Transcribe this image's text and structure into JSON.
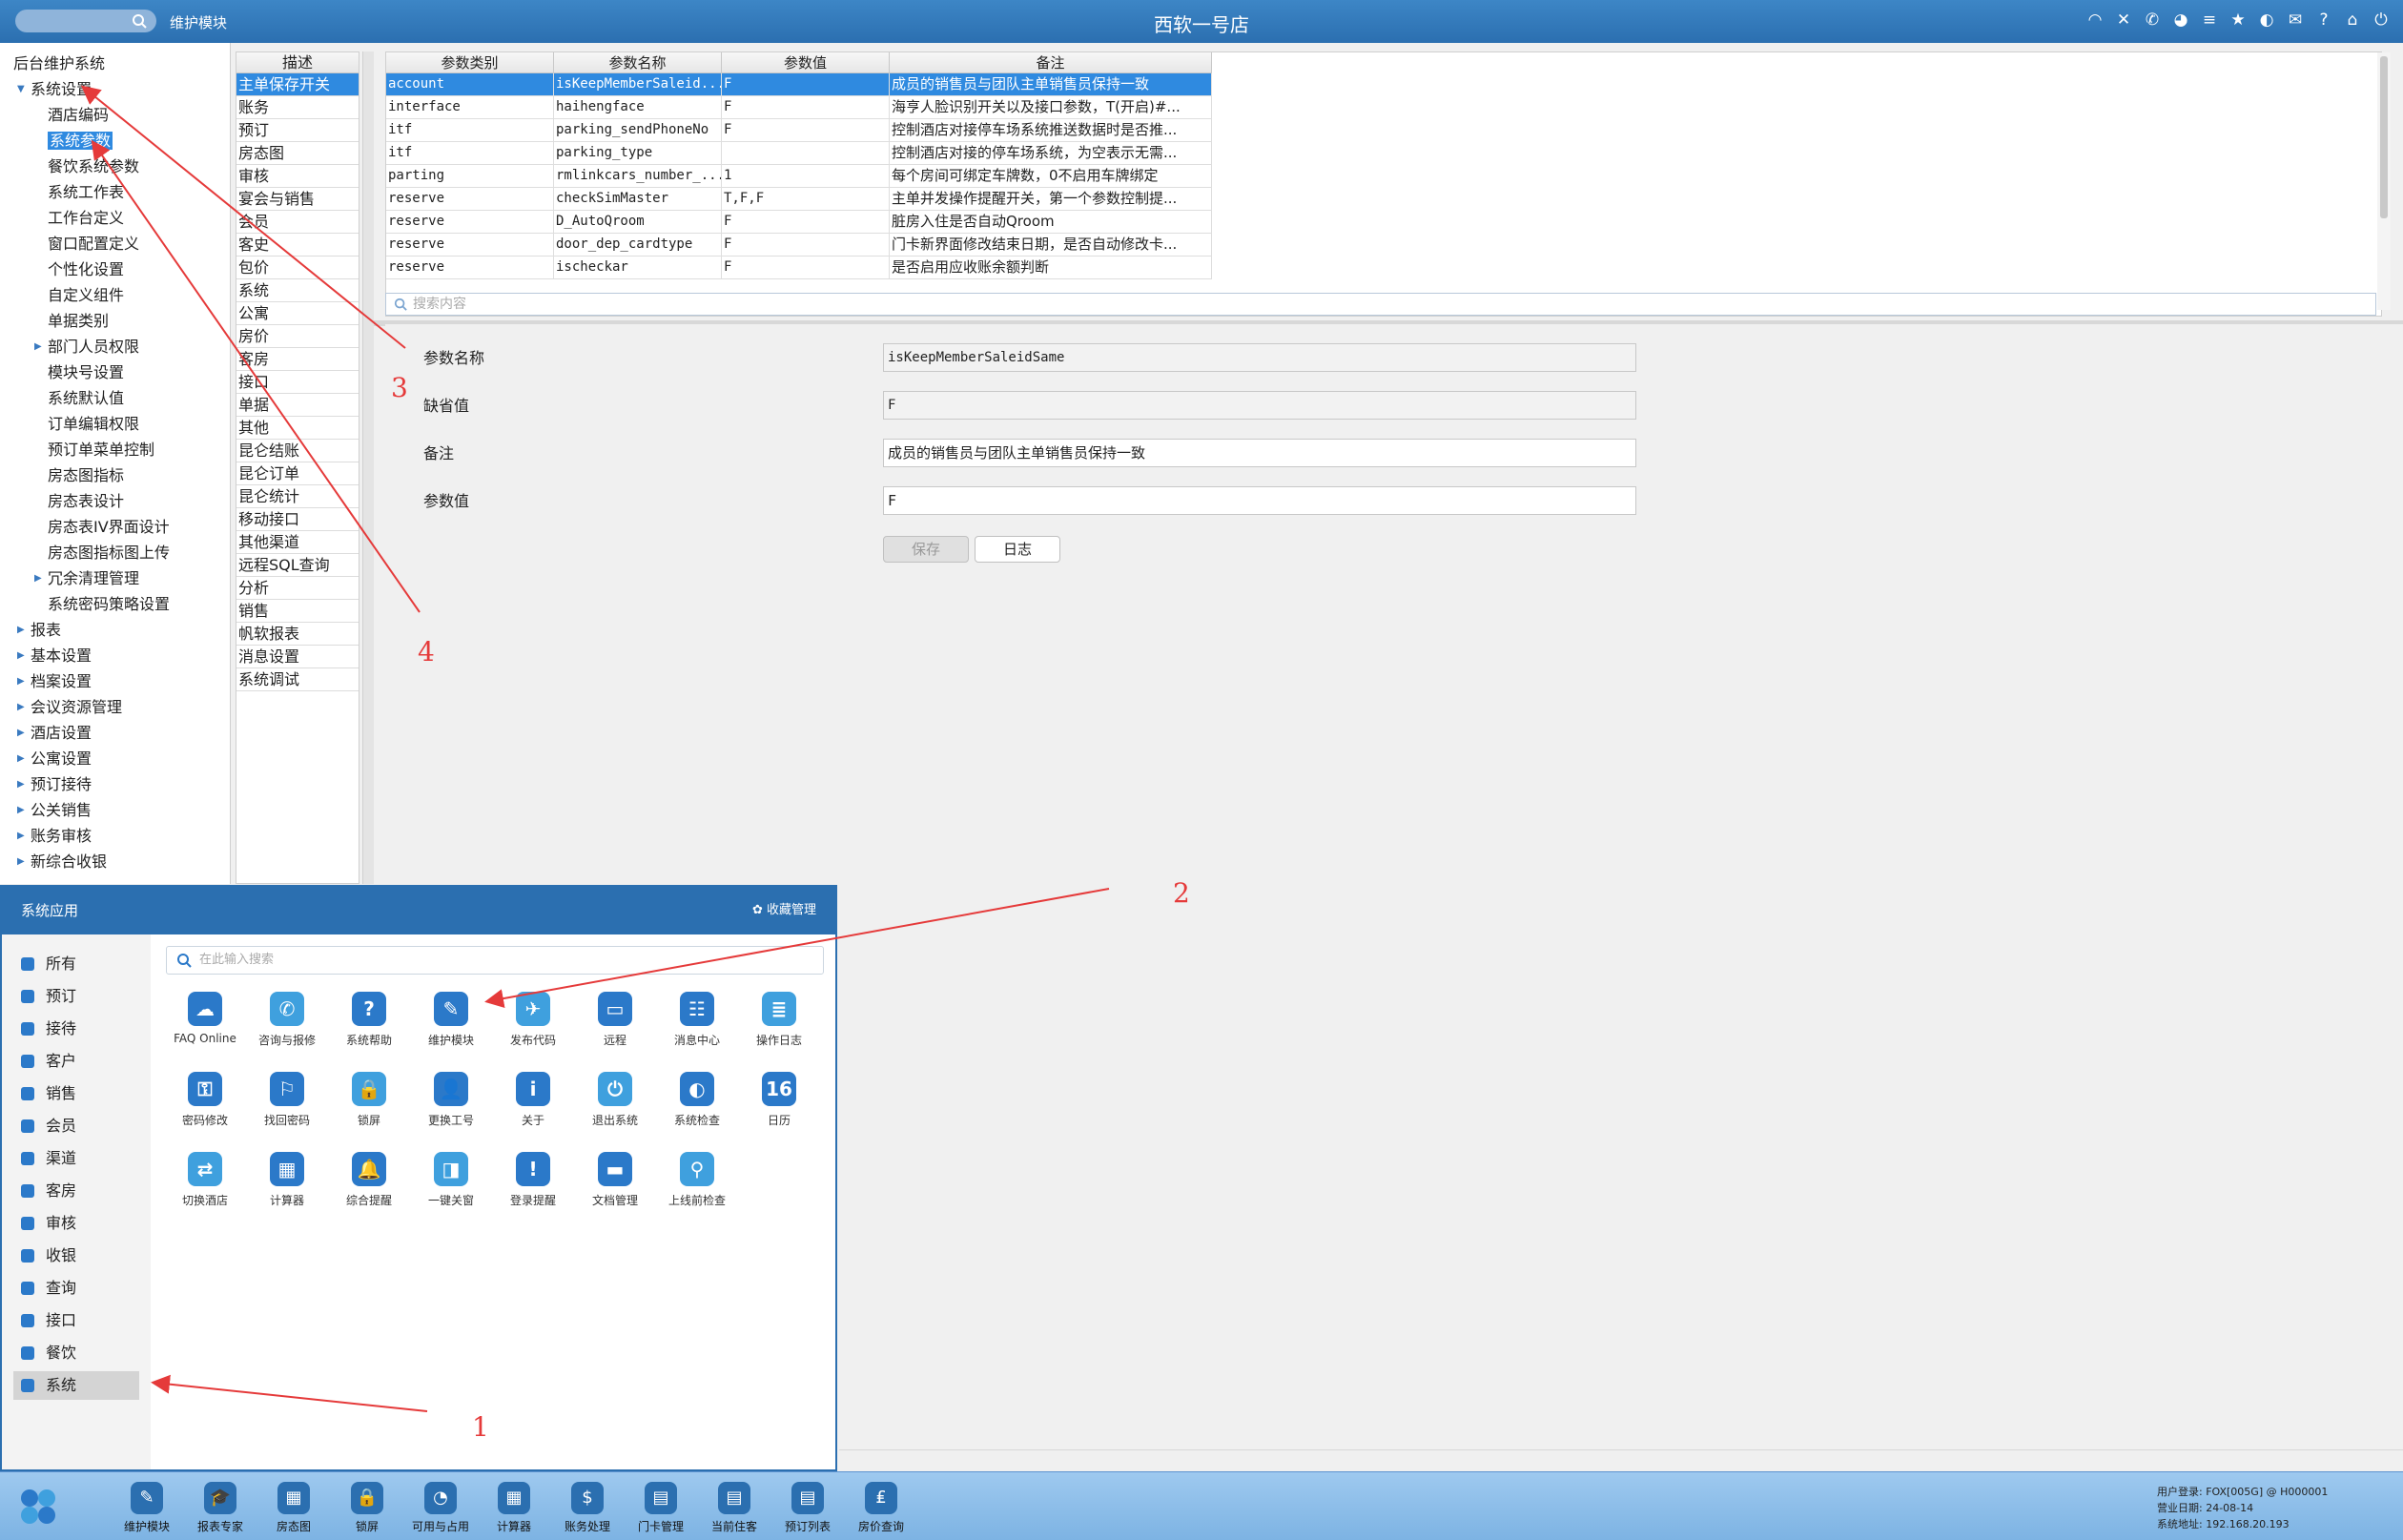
{
  "titlebar": {
    "module": "维护模块",
    "hotel": "西软一号店",
    "icons": [
      "wifi-icon",
      "tools-icon",
      "phone-icon",
      "palette-icon",
      "menu-icon",
      "star-icon",
      "contrast-icon",
      "mail-icon",
      "help-icon",
      "home-icon",
      "power-icon"
    ]
  },
  "tree": {
    "root": "后台维护系统",
    "items": [
      {
        "label": "系统设置",
        "level": 1,
        "expanded": true
      },
      {
        "label": "酒店编码",
        "level": 2
      },
      {
        "label": "系统参数",
        "level": 2,
        "selected": true
      },
      {
        "label": "餐饮系统参数",
        "level": 2
      },
      {
        "label": "系统工作表",
        "level": 2
      },
      {
        "label": "工作台定义",
        "level": 2
      },
      {
        "label": "窗口配置定义",
        "level": 2
      },
      {
        "label": "个性化设置",
        "level": 2
      },
      {
        "label": "自定义组件",
        "level": 2
      },
      {
        "label": "单据类别",
        "level": 2
      },
      {
        "label": "部门人员权限",
        "level": 2,
        "collapsed": true
      },
      {
        "label": "模块号设置",
        "level": 2
      },
      {
        "label": "系统默认值",
        "level": 2
      },
      {
        "label": "订单编辑权限",
        "level": 2
      },
      {
        "label": "预订单菜单控制",
        "level": 2
      },
      {
        "label": "房态图指标",
        "level": 2
      },
      {
        "label": "房态表设计",
        "level": 2
      },
      {
        "label": "房态表IV界面设计",
        "level": 2
      },
      {
        "label": "房态图指标图上传",
        "level": 2
      },
      {
        "label": "冗余清理管理",
        "level": 2,
        "collapsed": true
      },
      {
        "label": "系统密码策略设置",
        "level": 2
      },
      {
        "label": "报表",
        "level": 1,
        "collapsed": true
      },
      {
        "label": "基本设置",
        "level": 1,
        "collapsed": true
      },
      {
        "label": "档案设置",
        "level": 1,
        "collapsed": true
      },
      {
        "label": "会议资源管理",
        "level": 1,
        "collapsed": true
      },
      {
        "label": "酒店设置",
        "level": 1,
        "collapsed": true
      },
      {
        "label": "公寓设置",
        "level": 1,
        "collapsed": true
      },
      {
        "label": "预订接待",
        "level": 1,
        "collapsed": true
      },
      {
        "label": "公关销售",
        "level": 1,
        "collapsed": true
      },
      {
        "label": "账务审核",
        "level": 1,
        "collapsed": true
      },
      {
        "label": "新综合收银",
        "level": 1,
        "collapsed": true
      }
    ]
  },
  "desc_list": {
    "header": "描述",
    "items": [
      "主单保存开关",
      "账务",
      "预订",
      "房态图",
      "审核",
      "宴会与销售",
      "会员",
      "客史",
      "包价",
      "系统",
      "公寓",
      "房价",
      "客房",
      "接口",
      "单据",
      "其他",
      "昆仑结账",
      "昆仑订单",
      "昆仑统计",
      "移动接口",
      "其他渠道",
      "远程SQL查询",
      "分析",
      "销售",
      "帆软报表",
      "消息设置",
      "系统调试"
    ]
  },
  "grid": {
    "headers": [
      "参数类别",
      "参数名称",
      "参数值",
      "备注"
    ],
    "rows": [
      [
        "account",
        "isKeepMemberSaleid...",
        "F",
        "成员的销售员与团队主单销售员保持一致"
      ],
      [
        "interface",
        "haihengface",
        "F",
        "海亨人脸识别开关以及接口参数，T(开启)#..."
      ],
      [
        "itf",
        "parking_sendPhoneNo",
        "F",
        "控制酒店对接停车场系统推送数据时是否推..."
      ],
      [
        "itf",
        "parking_type",
        "",
        "控制酒店对接的停车场系统，为空表示无需..."
      ],
      [
        "parting",
        "rmlinkcars_number_...",
        "1",
        "每个房间可绑定车牌数，0不启用车牌绑定"
      ],
      [
        "reserve",
        "checkSimMaster",
        "T,F,F",
        "主单并发操作提醒开关，第一个参数控制提..."
      ],
      [
        "reserve",
        "D_AutoQroom",
        "F",
        "脏房入住是否自动Qroom"
      ],
      [
        "reserve",
        "door_dep_cardtype",
        "F",
        "门卡新界面修改结束日期，是否自动修改卡..."
      ],
      [
        "reserve",
        "ischeckar",
        "F",
        "是否启用应收账余额判断"
      ]
    ],
    "search_placeholder": "搜索内容"
  },
  "form": {
    "name_label": "参数名称",
    "name_value": "isKeepMemberSaleidSame",
    "default_label": "缺省值",
    "default_value": "F",
    "remark_label": "备注",
    "remark_value": "成员的销售员与团队主单销售员保持一致",
    "value_label": "参数值",
    "value_value": "F",
    "save": "保存",
    "log": "日志"
  },
  "popup": {
    "title": "系统应用",
    "fav": "收藏管理",
    "search_placeholder": "在此输入搜索",
    "side": [
      "所有",
      "预订",
      "接待",
      "客户",
      "销售",
      "会员",
      "渠道",
      "客房",
      "审核",
      "收银",
      "查询",
      "接口",
      "餐饮",
      "系统"
    ],
    "apps": [
      "FAQ Online",
      "咨询与报修",
      "系统帮助",
      "维护模块",
      "发布代码",
      "远程",
      "消息中心",
      "操作日志",
      "密码修改",
      "找回密码",
      "锁屏",
      "更换工号",
      "关于",
      "退出系统",
      "系统检查",
      "日历",
      "切换酒店",
      "计算器",
      "综合提醒",
      "一键关窗",
      "登录提醒",
      "文档管理",
      "上线前检查"
    ],
    "app_glyphs": [
      "☁",
      "✆",
      "?",
      "✎",
      "✈",
      "▭",
      "☷",
      "≣",
      "⚿",
      "⚐",
      "🔒",
      "👤",
      "i",
      "⏻",
      "◐",
      "16",
      "⇄",
      "▦",
      "🔔",
      "◨",
      "!",
      "▬",
      "⚲"
    ]
  },
  "taskbar": {
    "items": [
      "维护模块",
      "报表专家",
      "房态图",
      "锁屏",
      "可用与占用",
      "计算器",
      "账务处理",
      "门卡管理",
      "当前住客",
      "预订列表",
      "房价查询"
    ],
    "glyphs": [
      "✎",
      "🎓",
      "▦",
      "🔒",
      "◔",
      "▦",
      "$",
      "▤",
      "▤",
      "▤",
      "₤"
    ],
    "user": "用户登录:   FOX[005G] @ H000001",
    "date": "营业日期:   24-08-14",
    "addr": "系统地址:   192.168.20.193"
  },
  "annotations": [
    "1",
    "2",
    "3",
    "4"
  ],
  "colors": {
    "titlebar": "#2b6fb0",
    "selection": "#2f8ae0",
    "annotation": "#e53a3a"
  }
}
